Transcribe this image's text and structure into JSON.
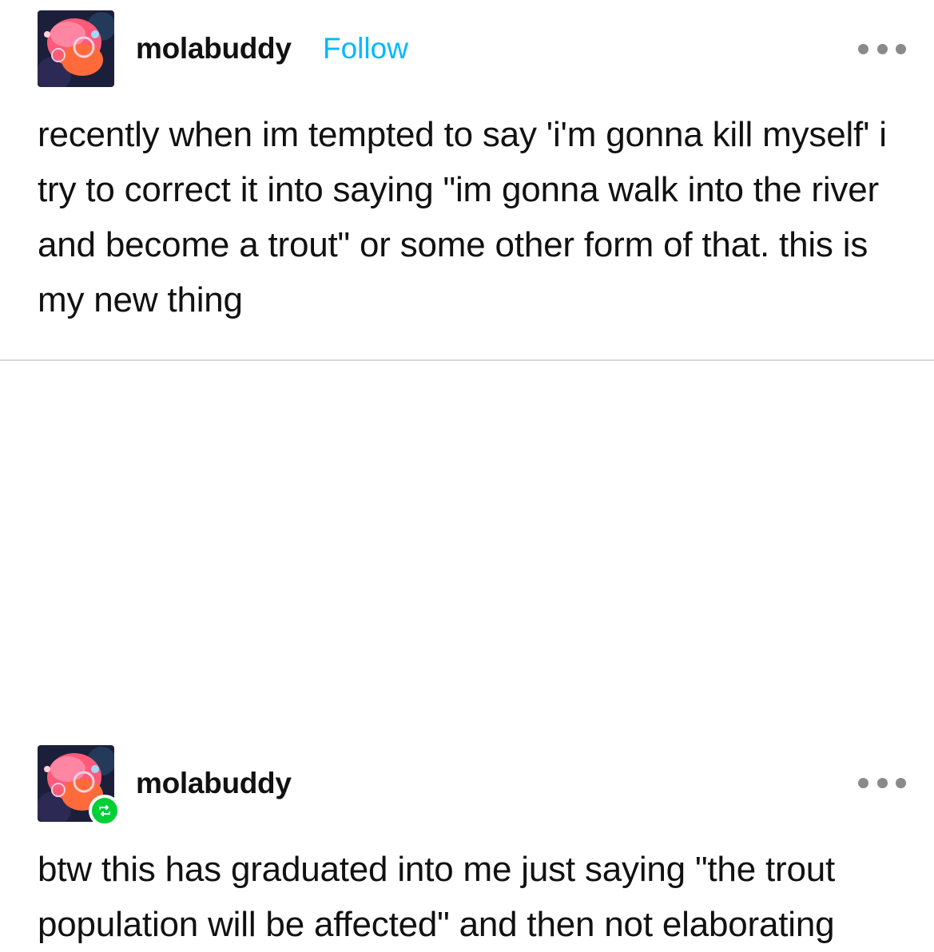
{
  "posts": [
    {
      "username": "molabuddy",
      "follow_label": "Follow",
      "text": "recently when im tempted to say 'i'm gonna kill myself' i try to correct it into saying \"im gonna walk into the river and become a trout\" or some other form of that. this is my new thing",
      "avatar_icon": "avatar-image",
      "more_icon": "more-options-icon"
    },
    {
      "username": "molabuddy",
      "text": "btw this has graduated into me just saying \"the trout population will be affected\" and then not elaborating",
      "avatar_icon": "avatar-image",
      "badge_icon": "reblog-icon",
      "more_icon": "more-options-icon"
    }
  ],
  "colors": {
    "follow": "#00b8ff",
    "reblog_badge": "#00cf35",
    "more_dots": "#8a8a8a",
    "divider": "#d8d8d8"
  }
}
